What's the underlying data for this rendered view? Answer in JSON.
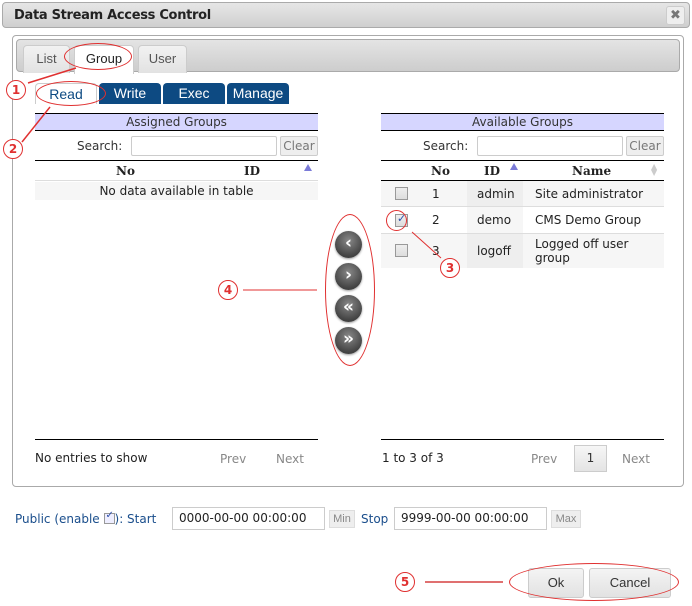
{
  "dialog": {
    "title": "Data Stream Access Control",
    "close_icon": "close-icon"
  },
  "tabs": [
    {
      "label": "List",
      "active": false
    },
    {
      "label": "Group",
      "active": true
    },
    {
      "label": "User",
      "active": false
    }
  ],
  "subtabs": [
    {
      "label": "Read",
      "active": true
    },
    {
      "label": "Write",
      "active": false
    },
    {
      "label": "Exec",
      "active": false
    },
    {
      "label": "Manage",
      "active": false
    }
  ],
  "assigned": {
    "heading": "Assigned Groups",
    "search_label": "Search:",
    "search_value": "",
    "clear_label": "Clear",
    "columns": [
      "No",
      "ID"
    ],
    "empty_message": "No data available in table",
    "footer_info": "No entries to show",
    "prev_label": "Prev",
    "next_label": "Next"
  },
  "available": {
    "heading": "Available Groups",
    "search_label": "Search:",
    "search_value": "",
    "clear_label": "Clear",
    "columns": [
      "No",
      "ID",
      "Name"
    ],
    "rows": [
      {
        "no": "1",
        "id": "admin",
        "name": "Site administrator",
        "checked": false
      },
      {
        "no": "2",
        "id": "demo",
        "name": "CMS Demo Group",
        "checked": true
      },
      {
        "no": "3",
        "id": "logoff",
        "name": "Logged off user group",
        "checked": false
      }
    ],
    "footer_info": "1 to 3 of 3",
    "prev_label": "Prev",
    "page": "1",
    "next_label": "Next"
  },
  "transfer_buttons": [
    {
      "icon": "chevron-left-icon",
      "glyph": "‹"
    },
    {
      "icon": "chevron-right-icon",
      "glyph": "›"
    },
    {
      "icon": "double-chevron-left-icon",
      "glyph": "«"
    },
    {
      "icon": "double-chevron-right-icon",
      "glyph": "»"
    }
  ],
  "public": {
    "label_prefix": "Public (enable",
    "label_suffix": "): Start",
    "enabled": true,
    "start_value": "0000-00-00 00:00:00",
    "min_label": "Min",
    "stop_label": "Stop",
    "stop_value": "9999-00-00 00:00:00",
    "max_label": "Max"
  },
  "buttons": {
    "ok_label": "Ok",
    "cancel_label": "Cancel"
  },
  "annotations": [
    "1",
    "2",
    "3",
    "4",
    "5"
  ],
  "colors": {
    "subtab_bg": "#0d4a82",
    "grid_header_bg": "#d6d6ff",
    "annotation_red": "#e03030",
    "public_text": "#1a4e8c"
  }
}
